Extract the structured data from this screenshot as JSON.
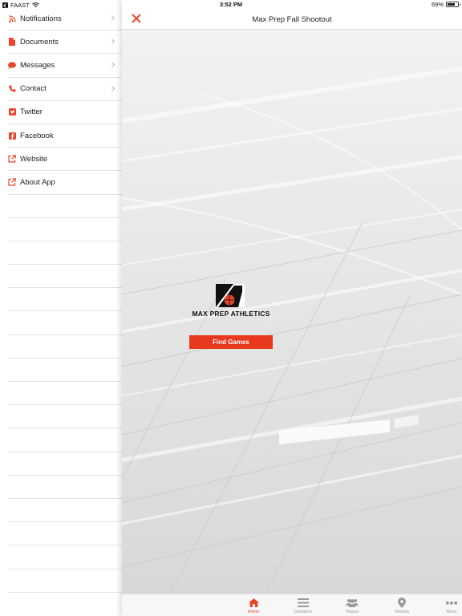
{
  "status_bar": {
    "carrier": "FAAST",
    "time": "3:52 PM",
    "battery": "69%"
  },
  "sidebar": {
    "items": [
      {
        "label": "Notifications",
        "icon": "rss-icon",
        "has_chevron": true
      },
      {
        "label": "Documents",
        "icon": "document-icon",
        "has_chevron": true
      },
      {
        "label": "Messages",
        "icon": "chat-bubble-icon",
        "has_chevron": true
      },
      {
        "label": "Contact",
        "icon": "phone-icon",
        "has_chevron": true
      },
      {
        "label": "Twitter",
        "icon": "twitter-icon",
        "has_chevron": false
      },
      {
        "label": "Facebook",
        "icon": "facebook-icon",
        "has_chevron": false
      },
      {
        "label": "Website",
        "icon": "external-link-icon",
        "has_chevron": false
      },
      {
        "label": "About App",
        "icon": "external-link-icon",
        "has_chevron": false
      }
    ]
  },
  "header": {
    "title": "Max Prep Fall Shootout"
  },
  "hero": {
    "brand": "MAX PREP ATHLETICS",
    "cta_label": "Find Games"
  },
  "tabs": [
    {
      "label": "Home",
      "icon": "home-icon",
      "active": true
    },
    {
      "label": "Divisions",
      "icon": "list-icon",
      "active": false
    },
    {
      "label": "Teams",
      "icon": "people-icon",
      "active": false
    },
    {
      "label": "Venues",
      "icon": "map-pin-icon",
      "active": false
    },
    {
      "label": "More",
      "icon": "more-icon",
      "active": false
    }
  ],
  "colors": {
    "accent": "#e8452a",
    "button": "#e8381d",
    "tab_inactive": "#999999"
  }
}
